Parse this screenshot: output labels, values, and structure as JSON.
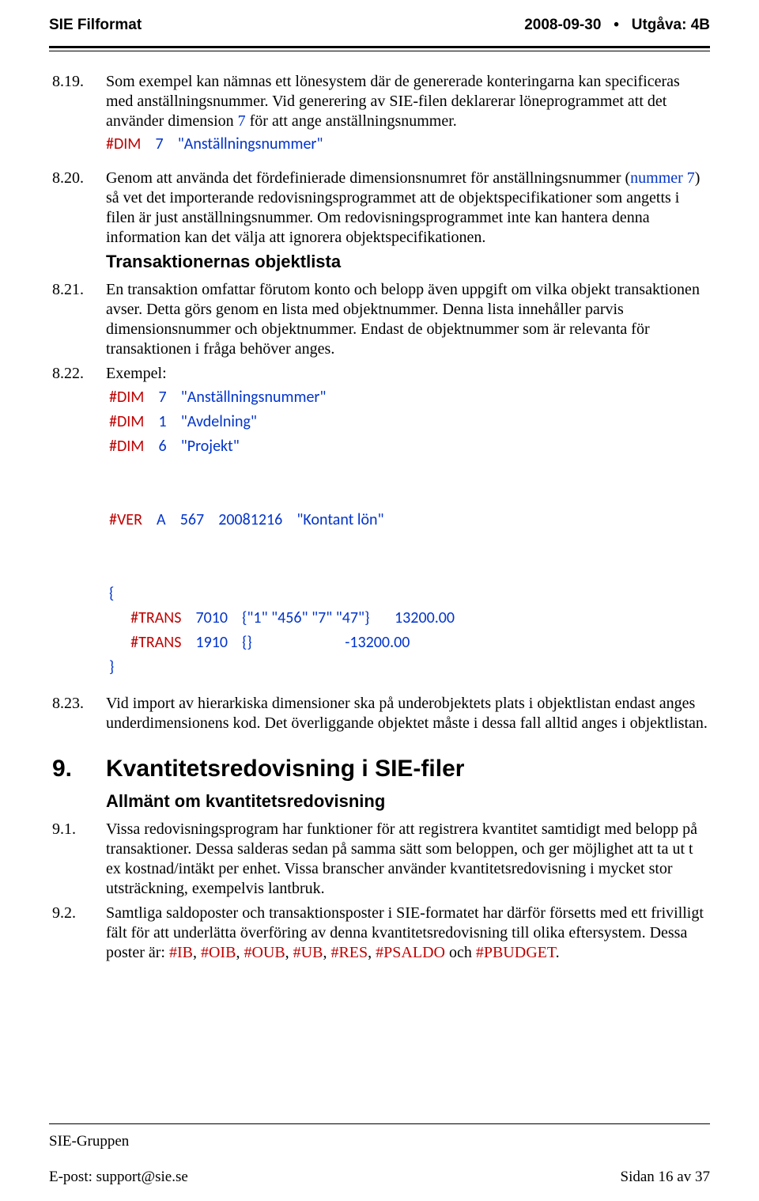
{
  "header": {
    "left": "SIE Filformat",
    "right_date": "2008-09-30",
    "right_bullet": "•",
    "right_edition": "Utgåva: 4B"
  },
  "items": {
    "i819": {
      "num": "8.19.",
      "p1a": "Som exempel kan nämnas ett lönesystem där de genererade konteringarna kan specificeras med anställningsnummer. Vid generering av SIE-filen deklarerar löneprogrammet att det använder dimension ",
      "p1b": "7",
      "p1c": " för att ange anställningsnummer.",
      "code": {
        "kw": "#DIM",
        "n": "7",
        "v": "\"Anställningsnummer\""
      }
    },
    "i820": {
      "num": "8.20.",
      "p1a": "Genom att använda det fördefinierade dimensionsnumret för anställningsnummer (",
      "p1b": "nummer 7",
      "p1c": ") så vet det importerande redovisningsprogrammet att de objektspecifikationer som angetts i filen är just anställningsnummer. Om redovisningsprogrammet inte kan hantera denna information kan det välja att ignorera objektspecifikationen."
    },
    "sub1": "Transaktionernas objektlista",
    "i821": {
      "num": "8.21.",
      "p": "En transaktion omfattar förutom konto och belopp även uppgift om vilka objekt transaktionen avser. Detta görs genom en lista med objektnummer. Denna lista innehåller parvis dimensionsnummer och objektnummer. Endast de objektnummer som är relevanta för transaktionen i fråga behöver anges."
    },
    "i822": {
      "num": "8.22.",
      "label": "Exempel:",
      "dim1": {
        "kw": "#DIM",
        "n": "7",
        "v": "\"Anställningsnummer\""
      },
      "dim2": {
        "kw": "#DIM",
        "n": "1",
        "v": "\"Avdelning\""
      },
      "dim3": {
        "kw": "#DIM",
        "n": "6",
        "v": "\"Projekt\""
      },
      "ver": {
        "kw": "#VER",
        "a": "A",
        "b": "567",
        "c": "20081216",
        "d": "\"Kontant lön\""
      },
      "brace_open": "{",
      "trans1": {
        "kw": "#TRANS",
        "a": "7010",
        "b": "{\"1\" \"456\" \"7\" \"47\"}",
        "c": "13200.00"
      },
      "trans2": {
        "kw": "#TRANS",
        "a": "1910",
        "b": "{}",
        "c": "-13200.00"
      },
      "brace_close": "}"
    },
    "i823": {
      "num": "8.23.",
      "p": "Vid import av hierarkiska dimensioner ska på underobjektets plats i objektlistan endast anges underdimensionens kod. Det överliggande objektet måste i dessa fall alltid anges i objektlistan."
    },
    "h2": {
      "num": "9.",
      "title": "Kvantitetsredovisning i SIE-filer"
    },
    "sub2": "Allmänt om kvantitetsredovisning",
    "i91": {
      "num": "9.1.",
      "p": "Vissa redovisningsprogram har funktioner för att registrera kvantitet samtidigt med belopp på transaktioner. Dessa salderas sedan på samma sätt som beloppen, och ger möjlighet att ta ut t ex kostnad/intäkt per enhet. Vissa branscher använder kvantitetsredovisning i mycket stor utsträckning, exempelvis lantbruk."
    },
    "i92": {
      "num": "9.2.",
      "p1": "Samtliga saldoposter och transaktionsposter i SIE-formatet har därför försetts med ett frivilligt fält för att underlätta överföring av denna kvantitetsredovisning till olika eftersystem. Dessa poster är: ",
      "codes": [
        "#IB",
        "#OIB",
        "#OUB",
        "#UB",
        "#RES",
        "#PSALDO",
        "#PBUDGET"
      ],
      "sep": ", ",
      "and": " och ",
      "end": "."
    }
  },
  "footer": {
    "group": "SIE-Gruppen",
    "email_label": "E-post: support@sie.se",
    "page": "Sidan 16 av 37"
  }
}
